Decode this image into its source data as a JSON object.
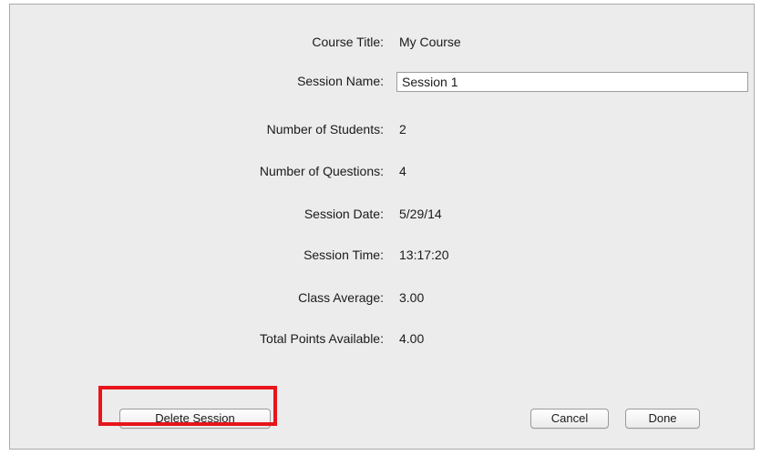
{
  "form": {
    "course_title_label": "Course Title:",
    "course_title_value": "My Course",
    "session_name_label": "Session Name:",
    "session_name_value": "Session 1",
    "num_students_label": "Number of Students:",
    "num_students_value": "2",
    "num_questions_label": "Number of Questions:",
    "num_questions_value": "4",
    "session_date_label": "Session Date:",
    "session_date_value": "5/29/14",
    "session_time_label": "Session Time:",
    "session_time_value": "13:17:20",
    "class_average_label": "Class Average:",
    "class_average_value": "3.00",
    "total_points_label": "Total Points Available:",
    "total_points_value": "4.00"
  },
  "buttons": {
    "delete_session": "Delete Session",
    "cancel": "Cancel",
    "done": "Done"
  },
  "colors": {
    "highlight": "#e8151b",
    "dialog_background": "#ececec"
  }
}
